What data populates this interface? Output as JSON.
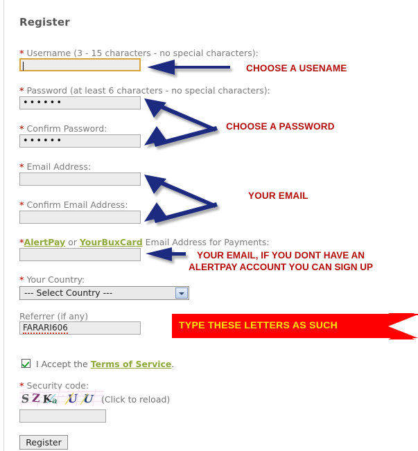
{
  "page": {
    "title": "Register"
  },
  "fields": {
    "username": {
      "label_prefix": "*",
      "label": " Username (3 - 15 characters - no special characters):",
      "value": "",
      "placeholder": ""
    },
    "password": {
      "label_prefix": "*",
      "label": " Password (at least 6 characters - no special characters):",
      "value": "••••••",
      "placeholder": ""
    },
    "confirm_password": {
      "label_prefix": "*",
      "label": " Confirm Password:",
      "value": "••••••",
      "placeholder": ""
    },
    "email": {
      "label_prefix": "*",
      "label": " Email Address:",
      "value": "",
      "placeholder": ""
    },
    "confirm_email": {
      "label_prefix": "*",
      "label": " Confirm Email Address:",
      "value": "",
      "placeholder": ""
    },
    "payment_email": {
      "label_prefix": "*",
      "link1": "AlertPay",
      "between": " or ",
      "link2": "YourBuxCard",
      "label_suffix": " Email Address for Payments:",
      "value": "",
      "placeholder": ""
    },
    "country": {
      "label_prefix": "*",
      "label": " Your Country:",
      "selected": "--- Select Country ---"
    },
    "referrer": {
      "label": "Referrer (if any)",
      "value": "FARARI606",
      "placeholder": ""
    },
    "terms": {
      "checked": true,
      "text_before": "I Accept the ",
      "link": "Terms of Service",
      "text_after": "."
    },
    "security_code": {
      "label_prefix": "*",
      "label": " Security code:",
      "captcha_text": "SZKaUU",
      "reload_hint": "(Click to reload)",
      "value": "",
      "placeholder": ""
    }
  },
  "buttons": {
    "register": "Register"
  },
  "annotations": {
    "username_note": "CHOOSE A USENAME",
    "password_note": "CHOOSE A PASSWORD",
    "email_note": "YOUR EMAIL",
    "payment_note_line1": "YOUR EMAIL, IF YOU DONT HAVE AN",
    "payment_note_line2": "ALERTPAY ACCOUNT YOU CAN SIGN UP",
    "referrer_note": "TYPE THESE LETTERS AS SUCH"
  },
  "colors": {
    "annotation_red": "#b30707",
    "banner_red": "#ff0000",
    "banner_text_yellow": "#ffe800",
    "arrow_navy": "#1a2a80",
    "link_green": "#8ea83c",
    "required_asterisk": "#c0392b",
    "focus_border": "#d8a43a"
  }
}
